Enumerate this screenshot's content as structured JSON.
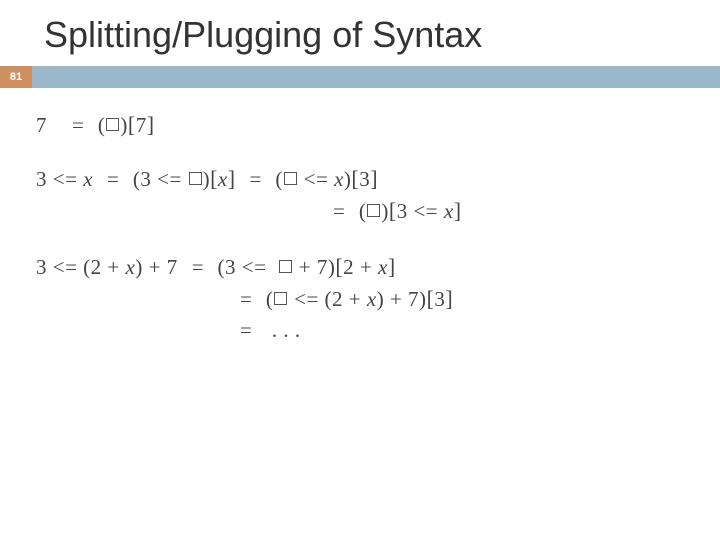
{
  "title": "Splitting/Plugging of Syntax",
  "page_number": "81",
  "equations": {
    "row1_lhs": "7",
    "row1_eq": "=",
    "row1_rhs": "(□)[7]",
    "row2_lhs": "3 <= x",
    "row2_eq": "=",
    "row2_m1": "(3 <= □)[x]",
    "row2_eq2": "=",
    "row2_m2": "(□ <= x)[3]",
    "row2b_eq": "=",
    "row2b_rhs": "(□)[3 <= x]",
    "row3_lhs": "3 <= (2 + x) + 7",
    "row3_eq": "=",
    "row3_m1": "(3 <=  □ + 7)[2 + x]",
    "row3b_eq": "=",
    "row3b_rhs": "(□ <= (2 + x) + 7)[3]",
    "row3c_eq": "=",
    "row3c_rhs": ". . ."
  }
}
